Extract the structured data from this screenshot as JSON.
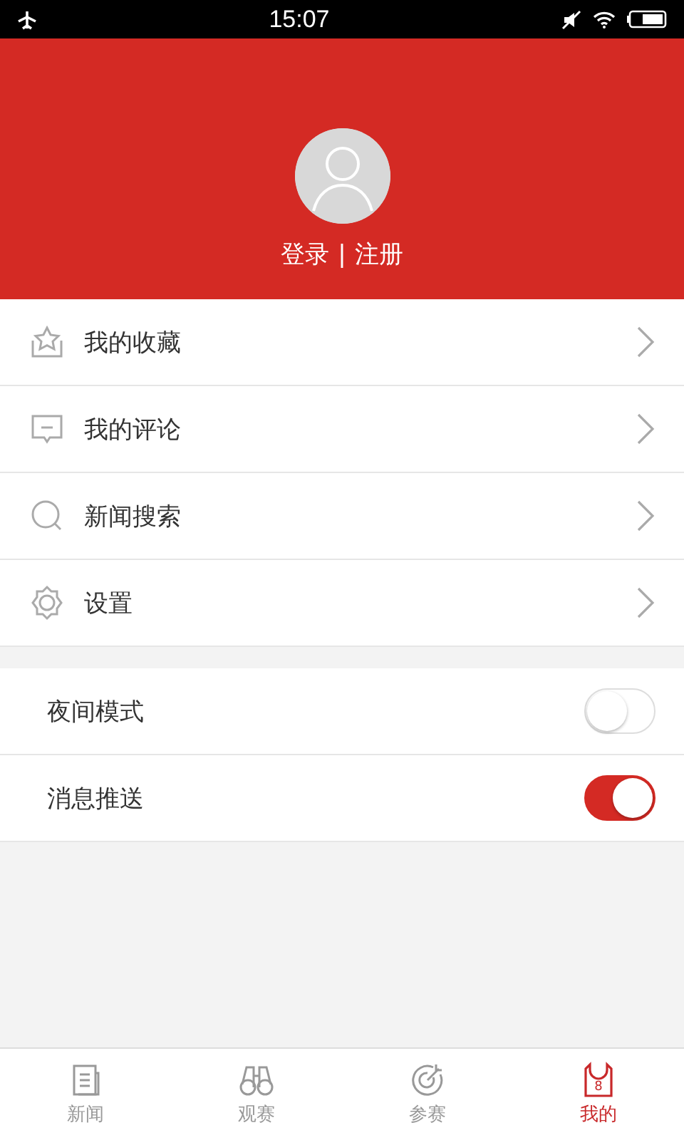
{
  "status_bar": {
    "time": "15:07"
  },
  "profile": {
    "login": "登录",
    "separator": "|",
    "register": "注册"
  },
  "menu": [
    {
      "kind": "star",
      "label": "我的收藏"
    },
    {
      "kind": "comment",
      "label": "我的评论"
    },
    {
      "kind": "search",
      "label": "新闻搜索"
    },
    {
      "kind": "gear",
      "label": "设置"
    }
  ],
  "toggles": [
    {
      "label": "夜间模式",
      "on": false
    },
    {
      "label": "消息推送",
      "on": true
    }
  ],
  "tabs": [
    {
      "kind": "news",
      "label": "新闻",
      "selected": false
    },
    {
      "kind": "binoculars",
      "label": "观赛",
      "selected": false
    },
    {
      "kind": "target",
      "label": "参赛",
      "selected": false
    },
    {
      "kind": "jersey",
      "label": "我的",
      "selected": true,
      "icon_number": "8"
    }
  ]
}
